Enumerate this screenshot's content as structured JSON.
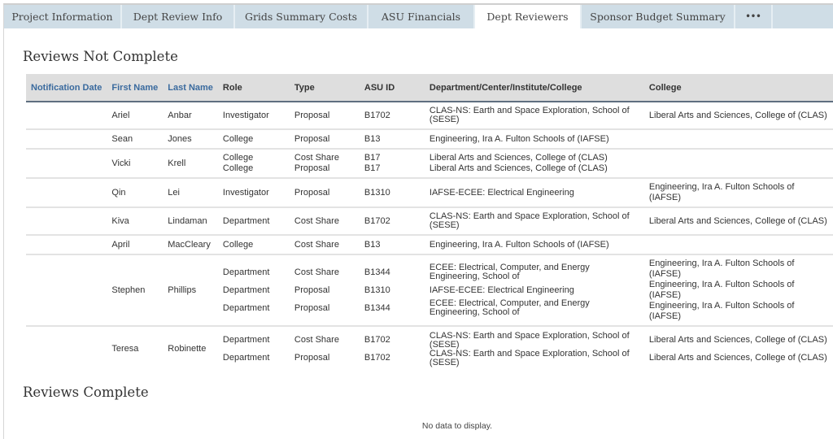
{
  "tabs": [
    {
      "label": "Project Information",
      "active": false
    },
    {
      "label": "Dept Review Info",
      "active": false
    },
    {
      "label": "Grids Summary Costs",
      "active": false
    },
    {
      "label": "ASU Financials",
      "active": false
    },
    {
      "label": "Dept Reviewers",
      "active": true
    },
    {
      "label": "Sponsor Budget Summary",
      "active": false
    },
    {
      "label": "•••",
      "active": false,
      "icon": "more-icon"
    }
  ],
  "reviews_not_complete": {
    "title": "Reviews Not Complete",
    "columns": [
      "Notification Date",
      "First Name",
      "Last Name",
      "Role",
      "Type",
      "ASU ID",
      "Department/Center/Institute/College",
      "College"
    ],
    "rows": [
      {
        "notification_date": "",
        "first_name": "Ariel",
        "last_name": "Anbar",
        "entries": [
          {
            "role": "Investigator",
            "type": "Proposal",
            "asu_id": "B1702",
            "department": "CLAS-NS: Earth and Space Exploration, School of (SESE)",
            "college": "Liberal Arts and Sciences, College of (CLAS)"
          }
        ]
      },
      {
        "notification_date": "",
        "first_name": "Sean",
        "last_name": "Jones",
        "entries": [
          {
            "role": "College",
            "type": "Proposal",
            "asu_id": "B13",
            "department": "Engineering, Ira A. Fulton Schools of (IAFSE)",
            "college": ""
          }
        ]
      },
      {
        "notification_date": "",
        "first_name": "Vicki",
        "last_name": "Krell",
        "entries": [
          {
            "role": "College",
            "type": "Cost Share",
            "asu_id": "B17",
            "department": "Liberal Arts and Sciences, College of (CLAS)",
            "college": ""
          },
          {
            "role": "College",
            "type": "Proposal",
            "asu_id": "B17",
            "department": "Liberal Arts and Sciences, College of (CLAS)",
            "college": ""
          }
        ]
      },
      {
        "notification_date": "",
        "first_name": "Qin",
        "last_name": "Lei",
        "entries": [
          {
            "role": "Investigator",
            "type": "Proposal",
            "asu_id": "B1310",
            "department": "IAFSE-ECEE: Electrical Engineering",
            "college": "Engineering, Ira A. Fulton Schools of (IAFSE)"
          }
        ]
      },
      {
        "notification_date": "",
        "first_name": "Kiva",
        "last_name": "Lindaman",
        "entries": [
          {
            "role": "Department",
            "type": "Cost Share",
            "asu_id": "B1702",
            "department": "CLAS-NS: Earth and Space Exploration, School of (SESE)",
            "college": "Liberal Arts and Sciences, College of (CLAS)"
          }
        ]
      },
      {
        "notification_date": "",
        "first_name": "April",
        "last_name": "MacCleary",
        "entries": [
          {
            "role": "College",
            "type": "Cost Share",
            "asu_id": "B13",
            "department": "Engineering, Ira A. Fulton Schools of (IAFSE)",
            "college": ""
          }
        ]
      },
      {
        "notification_date": "",
        "first_name": "Stephen",
        "last_name": "Phillips",
        "entries": [
          {
            "role": "Department",
            "type": "Cost Share",
            "asu_id": "B1344",
            "department": "ECEE: Electrical, Computer, and Energy Engineering, School of",
            "college": "Engineering, Ira A. Fulton Schools of (IAFSE)"
          },
          {
            "role": "Department",
            "type": "Proposal",
            "asu_id": "B1310",
            "department": "IAFSE-ECEE: Electrical Engineering",
            "college": "Engineering, Ira A. Fulton Schools of (IAFSE)"
          },
          {
            "role": "Department",
            "type": "Proposal",
            "asu_id": "B1344",
            "department": "ECEE: Electrical, Computer, and Energy Engineering, School of",
            "college": "Engineering, Ira A. Fulton Schools of (IAFSE)"
          }
        ]
      },
      {
        "notification_date": "",
        "first_name": "Teresa",
        "last_name": "Robinette",
        "entries": [
          {
            "role": "Department",
            "type": "Cost Share",
            "asu_id": "B1702",
            "department": "CLAS-NS: Earth and Space Exploration, School of (SESE)",
            "college": "Liberal Arts and Sciences, College of (CLAS)"
          },
          {
            "role": "Department",
            "type": "Proposal",
            "asu_id": "B1702",
            "department": "CLAS-NS: Earth and Space Exploration, School of (SESE)",
            "college": "Liberal Arts and Sciences, College of (CLAS)"
          }
        ]
      }
    ]
  },
  "reviews_complete": {
    "title": "Reviews Complete",
    "empty_message": "No data to display."
  },
  "colors": {
    "tab_bg": "#cfdde6",
    "tab_active_bg": "#ffffff",
    "header_bg": "#dedede",
    "header_border": "#5f6f80",
    "sortable_header": "#3a6a9e"
  }
}
